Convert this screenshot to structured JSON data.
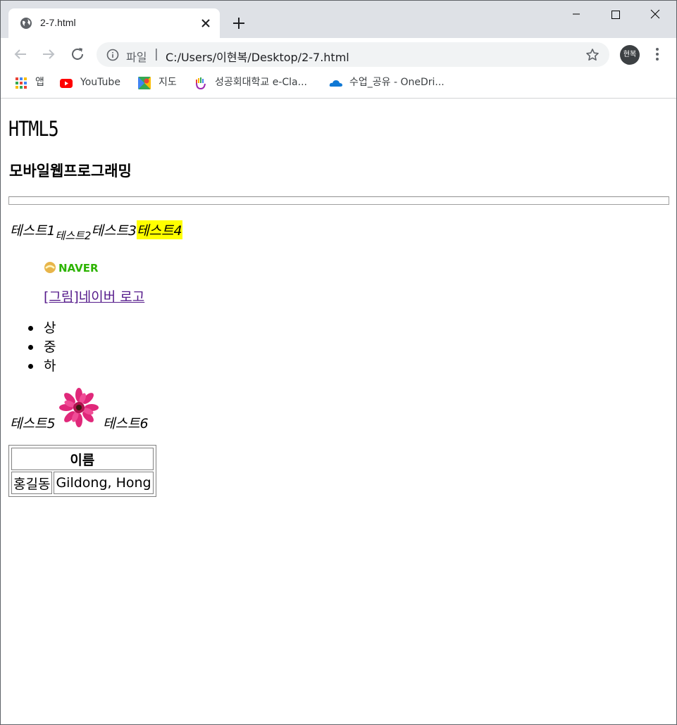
{
  "tab": {
    "title": "2-7.html"
  },
  "omnibox": {
    "scheme": "파일",
    "separator": "|",
    "url": "C:/Users/이현복/Desktop/2-7.html"
  },
  "profile": {
    "initials": "현복"
  },
  "bookmarks": [
    {
      "label": "앱",
      "icon": "apps-grid-icon"
    },
    {
      "label": "YouTube",
      "icon": "youtube-icon"
    },
    {
      "label": "지도",
      "icon": "maps-icon"
    },
    {
      "label": "성공회대학교 e-Cla...",
      "icon": "hand-logo-icon"
    },
    {
      "label": "수업_공유 - OneDri...",
      "icon": "onedrive-icon"
    }
  ],
  "page": {
    "h1": "HTML5",
    "h3": "모바일웹프로그래밍",
    "inline_tests": {
      "t1": "테스트1",
      "t2": "테스트2",
      "t3": "테스트3",
      "t4": "테스트4"
    },
    "figure": {
      "logo_text": "NAVER",
      "caption": "[그림]네이버 로고"
    },
    "list": [
      "상",
      "중",
      "하"
    ],
    "flower_line": {
      "t5": "테스트5",
      "t6": "테스트6"
    },
    "table": {
      "header": "이름",
      "row": [
        "홍길동",
        "Gildong, Hong"
      ]
    }
  },
  "colors": {
    "tabstrip": "#dee1e6",
    "highlight": "#ffff00",
    "link_visited": "#551a8b"
  }
}
